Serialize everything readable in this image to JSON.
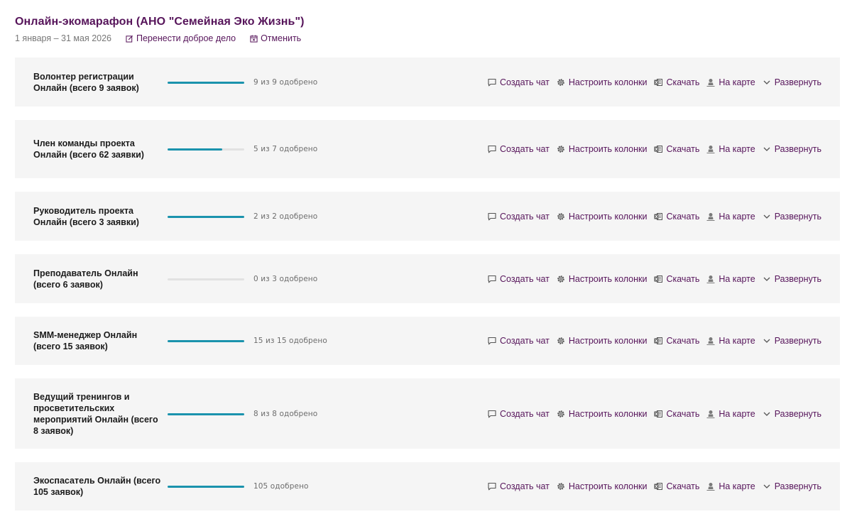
{
  "header": {
    "title": "Онлайн-экомарафон (АНО \"Семейная Эко Жизнь\")",
    "dates": "1 января – 31 мая 2026",
    "transfer_label": "Перенести доброе дело",
    "cancel_label": "Отменить"
  },
  "actions": {
    "chat": "Создать чат",
    "columns": "Настроить колонки",
    "download": "Скачать",
    "map": "На карте",
    "expand": "Развернуть"
  },
  "colors": {
    "accent": "#56145a",
    "progress": "#1b93ad",
    "row_bg": "#f5f5f5"
  },
  "roles": [
    {
      "name": "Волонтер регистрации Онлайн (всего 9 заявок)",
      "status": "9 из 9 одобрено",
      "progress": 1.0
    },
    {
      "name": "Член команды проекта Онлайн (всего 62 заявки)",
      "status": "5 из 7 одобрено",
      "progress": 0.714
    },
    {
      "name": "Руководитель проекта Онлайн (всего 3 заявки)",
      "status": "2 из 2 одобрено",
      "progress": 1.0
    },
    {
      "name": "Преподаватель Онлайн (всего 6 заявок)",
      "status": "0 из 3 одобрено",
      "progress": 0.0
    },
    {
      "name": "SMM-менеджер Онлайн (всего 15 заявок)",
      "status": "15 из 15 одобрено",
      "progress": 1.0
    },
    {
      "name": "Ведущий тренингов и просветительских мероприятий Онлайн (всего 8 заявок)",
      "status": "8 из 8 одобрено",
      "progress": 1.0
    },
    {
      "name": "Экоспасатель Онлайн (всего 105 заявок)",
      "status": "105 одобрено",
      "progress": 1.0
    }
  ]
}
